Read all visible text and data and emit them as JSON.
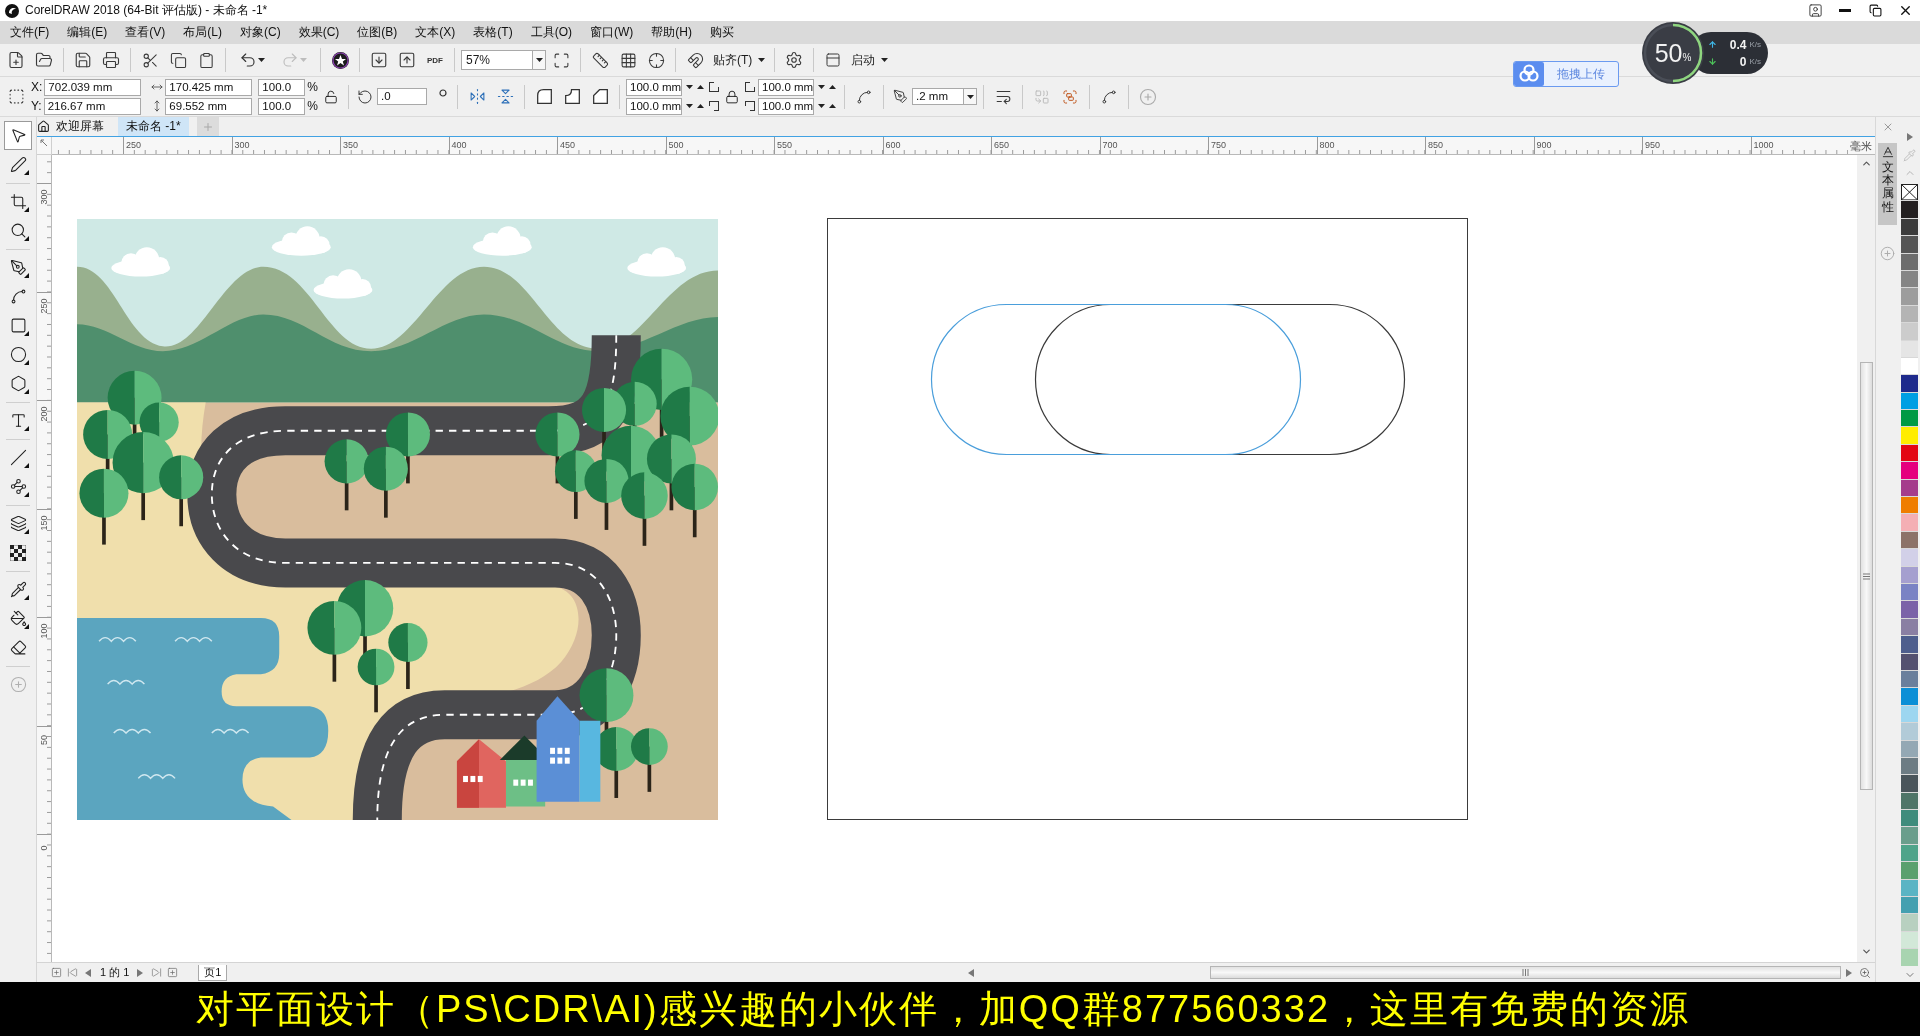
{
  "window": {
    "title": "CorelDRAW 2018 (64-Bit 评估版) - 未命名 -1*"
  },
  "menu": [
    "文件(F)",
    "编辑(E)",
    "查看(V)",
    "布局(L)",
    "对象(C)",
    "效果(C)",
    "位图(B)",
    "文本(X)",
    "表格(T)",
    "工具(O)",
    "窗口(W)",
    "帮助(H)",
    "购买"
  ],
  "standard_toolbar": {
    "undo": {
      "disabled": false
    },
    "redo": {
      "disabled": true
    },
    "pdf_label": "PDF",
    "zoom": "57%",
    "snap": "贴齐(T)",
    "launch": "启动"
  },
  "property_bar": {
    "position": [
      {
        "label": "X:",
        "value": "702.039 mm"
      },
      {
        "label": "Y:",
        "value": "216.67 mm"
      }
    ],
    "size": [
      "170.425 mm",
      "69.552 mm"
    ],
    "scale": [
      {
        "value": "100.0",
        "unit": "%"
      },
      {
        "value": "100.0",
        "unit": "%"
      }
    ],
    "rotation": ".0",
    "corner_radius_left": [
      "100.0 mm",
      "100.0 mm"
    ],
    "corner_radius_right": [
      "100.0 mm",
      "100.0 mm"
    ],
    "outline_width": ".2 mm"
  },
  "document_tabs": [
    {
      "kind": "home",
      "label": "欢迎屏幕",
      "selected": false
    },
    {
      "kind": "document",
      "label": "未命名 -1*",
      "selected": true
    }
  ],
  "rulers": {
    "unit": "毫米",
    "horizontal": [
      "250",
      "300",
      "350",
      "400",
      "450",
      "500",
      "550",
      "600",
      "650",
      "700",
      "750",
      "800",
      "850",
      "900",
      "950",
      "1000"
    ],
    "vertical": [
      "300",
      "250",
      "200",
      "150",
      "100",
      "50",
      "0"
    ]
  },
  "drawing_page": {
    "shapes": [
      {
        "color": "#4a9edb"
      },
      {
        "color": "#3a3a3a"
      }
    ]
  },
  "page_navigator": {
    "position": "1 的 1",
    "page_tab": "页1"
  },
  "docker": {
    "tab": "文本属性"
  },
  "palette": [
    {
      "color": "#231f20"
    },
    {
      "color": "#3c3c3c"
    },
    {
      "color": "#555555"
    },
    {
      "color": "#6d6d6d"
    },
    {
      "color": "#858585"
    },
    {
      "color": "#9d9d9d"
    },
    {
      "color": "#b4b4b4"
    },
    {
      "color": "#cccccc"
    },
    {
      "color": "#e5e5e5"
    },
    {
      "color": "#ffffff"
    },
    {
      "color": "#1e2a8c"
    },
    {
      "color": "#009fe3"
    },
    {
      "color": "#009a44"
    },
    {
      "color": "#ffed00"
    },
    {
      "color": "#e30613"
    },
    {
      "color": "#e5007e"
    },
    {
      "color": "#a53c8c"
    },
    {
      "color": "#ef7d00"
    },
    {
      "color": "#f4afb4"
    },
    {
      "color": "#8c7268"
    },
    {
      "color": "#d2d0e8"
    },
    {
      "color": "#a59fcf"
    },
    {
      "color": "#7a83c4"
    },
    {
      "color": "#7b62a8"
    },
    {
      "color": "#8a7fa3"
    },
    {
      "color": "#4e5e8d"
    },
    {
      "color": "#545170"
    },
    {
      "color": "#6a7f9c"
    },
    {
      "color": "#0c8fd6"
    },
    {
      "color": "#9dd6f0"
    },
    {
      "color": "#b2cbd8"
    },
    {
      "color": "#94a8b4"
    },
    {
      "color": "#6d7c84"
    },
    {
      "color": "#4a555b"
    },
    {
      "color": "#4f7568"
    },
    {
      "color": "#3f8c7c"
    },
    {
      "color": "#6a9e8c"
    },
    {
      "color": "#4fa48a"
    },
    {
      "color": "#5aa06e"
    },
    {
      "color": "#5ab4c4"
    },
    {
      "color": "#44a0b0"
    },
    {
      "color": "#b8d0c0"
    },
    {
      "color": "#d2e8d8"
    },
    {
      "color": "#a8d4b0"
    }
  ],
  "network_monitor": {
    "percent": "50",
    "percent_sign": "%",
    "level": 0.5,
    "upload": {
      "value": "0.4",
      "unit": "K/s"
    },
    "download": {
      "value": "0",
      "unit": "K/s"
    }
  },
  "upload_button": {
    "label": "拖拽上传"
  },
  "caption": "对平面设计（PS\\CDR\\AI)感兴趣的小伙伴，加QQ群877560332，这里有免费的资源"
}
